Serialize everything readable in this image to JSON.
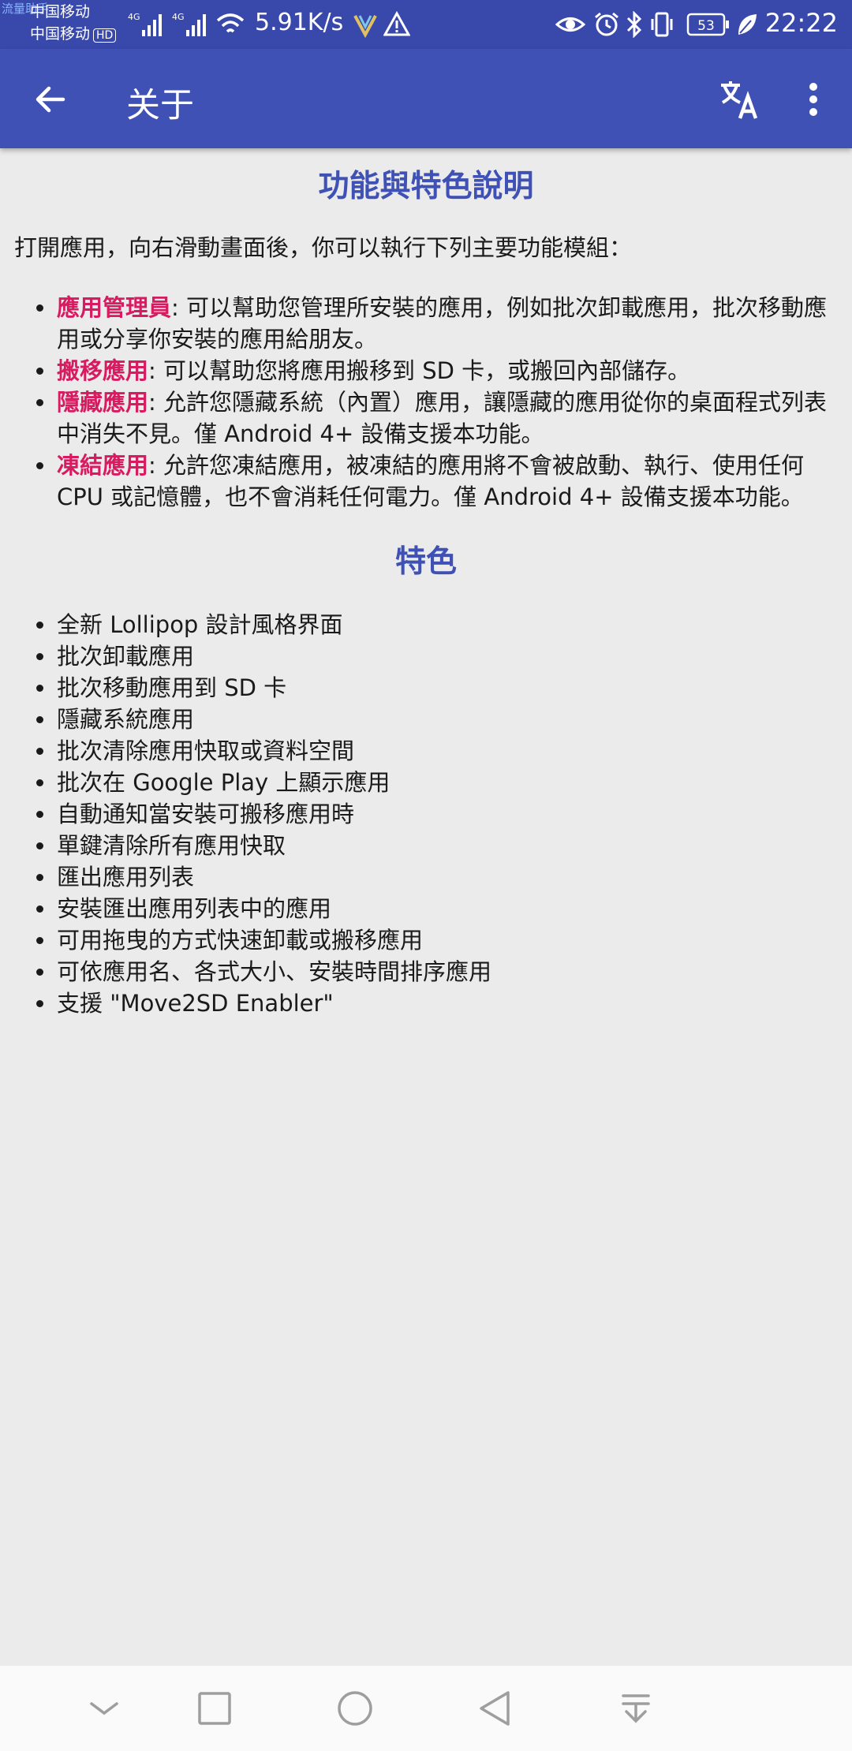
{
  "status_bar": {
    "overlay_label": "流量助手",
    "carrier1": "中国移动",
    "carrier2": "中国移动",
    "hd_badge": "HD",
    "signal_label1": "4G",
    "signal_label2": "4G",
    "net_speed": "5.91K/s",
    "battery": "53",
    "time": "22:22",
    "icons": [
      "eye-icon",
      "alarm-icon",
      "bluetooth-icon",
      "vibrate-icon",
      "battery-icon",
      "leaf-icon",
      "warning-icon",
      "vpn-icon",
      "wifi-icon"
    ]
  },
  "app_bar": {
    "title": "关于",
    "back_icon": "arrow-back-icon",
    "translate_icon": "translate-icon",
    "more_icon": "more-vert-icon",
    "bg_color": "#3f51b5"
  },
  "content": {
    "heading1": "功能與特色說明",
    "intro": "打開應用，向右滑動畫面後，你可以執行下列主要功能模組：",
    "modules": [
      {
        "name": "應用管理員",
        "desc": ": 可以幫助您管理所安裝的應用，例如批次卸載應用，批次移動應用或分享你安裝的應用給朋友。"
      },
      {
        "name": "搬移應用",
        "desc": ": 可以幫助您將應用搬移到 SD 卡，或搬回內部儲存。"
      },
      {
        "name": "隱藏應用",
        "desc": ": 允許您隱藏系統（內置）應用，讓隱藏的應用從你的桌面程式列表中消失不見。僅 Android 4+ 設備支援本功能。"
      },
      {
        "name": "凍結應用",
        "desc": ": 允許您凍結應用，被凍結的應用將不會被啟動、執行、使用任何 CPU 或記憶體，也不會消耗任何電力。僅 Android 4+ 設備支援本功能。"
      }
    ],
    "heading2": "特色",
    "features": [
      "全新 Lollipop 設計風格界面",
      "批次卸載應用",
      "批次移動應用到 SD 卡",
      "隱藏系統應用",
      "批次清除應用快取或資料空間",
      "批次在 Google Play 上顯示應用",
      "自動通知當安裝可搬移應用時",
      "單鍵清除所有應用快取",
      "匯出應用列表",
      "安裝匯出應用列表中的應用",
      "可用拖曳的方式快速卸載或搬移應用",
      "可依應用名、各式大小、安裝時間排序應用",
      "支援 \"Move2SD Enabler\""
    ],
    "heading_color": "#3f51b5",
    "highlight_color": "#d81b60"
  },
  "nav_bar": {
    "icons": [
      "collapse-down-icon",
      "recents-square-icon",
      "home-circle-icon",
      "back-triangle-icon",
      "notification-pull-icon"
    ]
  }
}
